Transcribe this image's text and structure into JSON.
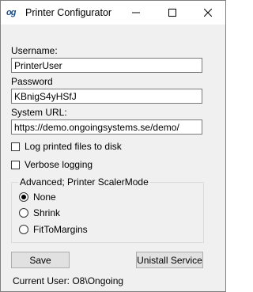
{
  "window": {
    "icon_text": "og",
    "title": "Printer Configurator"
  },
  "form": {
    "username_label": "Username:",
    "username_value": "PrinterUser",
    "password_label": "Password",
    "password_value": "KBnigS4yHSfJ",
    "url_label": "System URL:",
    "url_value": "https://demo.ongoingsystems.se/demo/",
    "log_printed_label": "Log printed files to disk",
    "log_printed_checked": false,
    "verbose_label": "Verbose logging",
    "verbose_checked": false
  },
  "scaler": {
    "group_title": "Advanced; Printer ScalerMode",
    "options": [
      {
        "label": "None",
        "selected": true
      },
      {
        "label": "Shrink",
        "selected": false
      },
      {
        "label": "FitToMargins",
        "selected": false
      }
    ]
  },
  "buttons": {
    "save": "Save",
    "uninstall": "Unistall Service"
  },
  "status": {
    "current_user": "Current User: O8\\Ongoing"
  },
  "colors": {
    "brand": "#1a4f8c",
    "window_bg": "#f0f0f0",
    "button_bg": "#e1e1e1"
  }
}
